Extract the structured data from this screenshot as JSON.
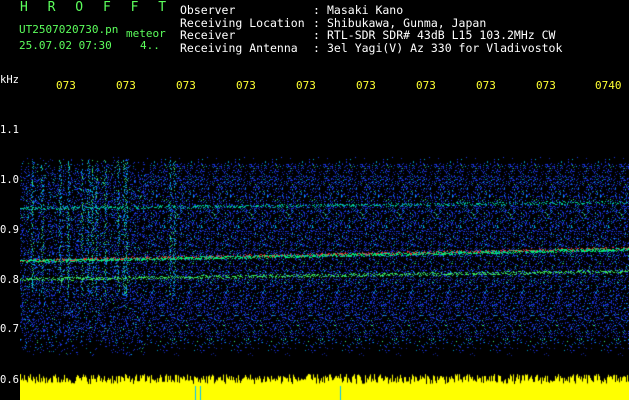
{
  "header": {
    "title": "H R O F F T",
    "filename": "UT2507020730.pn",
    "tag": "meteor",
    "datetime": "25.07.02 07:30",
    "count": "4.."
  },
  "info": [
    {
      "label": "Observer",
      "sep": ":",
      "value": "Masaki Kano"
    },
    {
      "label": "Receiving Location",
      "sep": ":",
      "value": "Shibukawa, Gunma, Japan"
    },
    {
      "label": "Receiver",
      "sep": ":",
      "value": "RTL-SDR SDR# 43dB L15 103.2MHz CW"
    },
    {
      "label": "Receiving Antenna",
      "sep": ":",
      "value": "3el Yagi(V) Az 330 for Vladivostok"
    }
  ],
  "axis": {
    "y_unit": "kHz",
    "y_labels": [
      "1.1",
      "1.0",
      "0.9",
      "0.8",
      "0.7",
      "0.6"
    ],
    "x_labels": [
      "073",
      "073",
      "073",
      "073",
      "073",
      "073",
      "073",
      "073",
      "073",
      "0740"
    ]
  },
  "colors": {
    "text": "#ffffff",
    "title": "#5cff5c",
    "time_ticks": "#ffff33",
    "background": "#000000",
    "noise": "#1e3cff",
    "carrier": "#ff3030",
    "meter": "#ffff00"
  }
}
